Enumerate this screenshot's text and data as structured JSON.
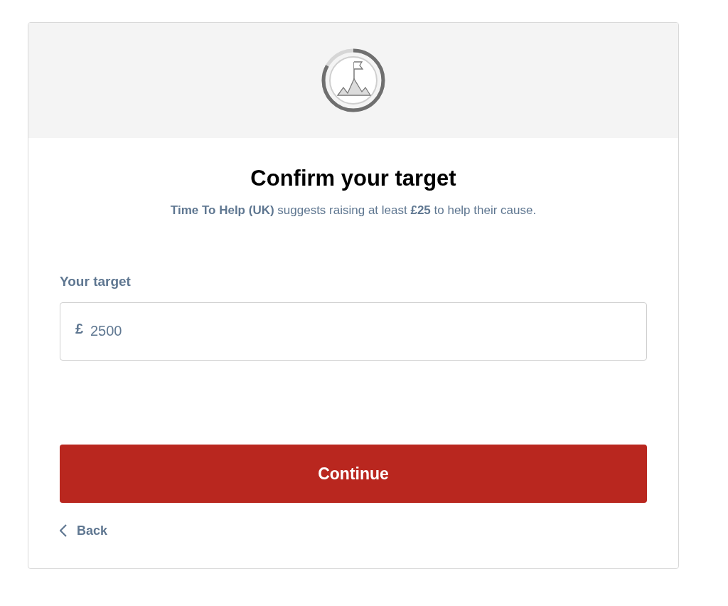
{
  "title": "Confirm your target",
  "subtitle": "**Time To Help (UK)** suggests raising at least **£25** to help their cause.",
  "target_field": {
    "label": "Your target",
    "currency": "£",
    "value": "2500"
  },
  "continue_button": "Continue",
  "back_link": "Back"
}
